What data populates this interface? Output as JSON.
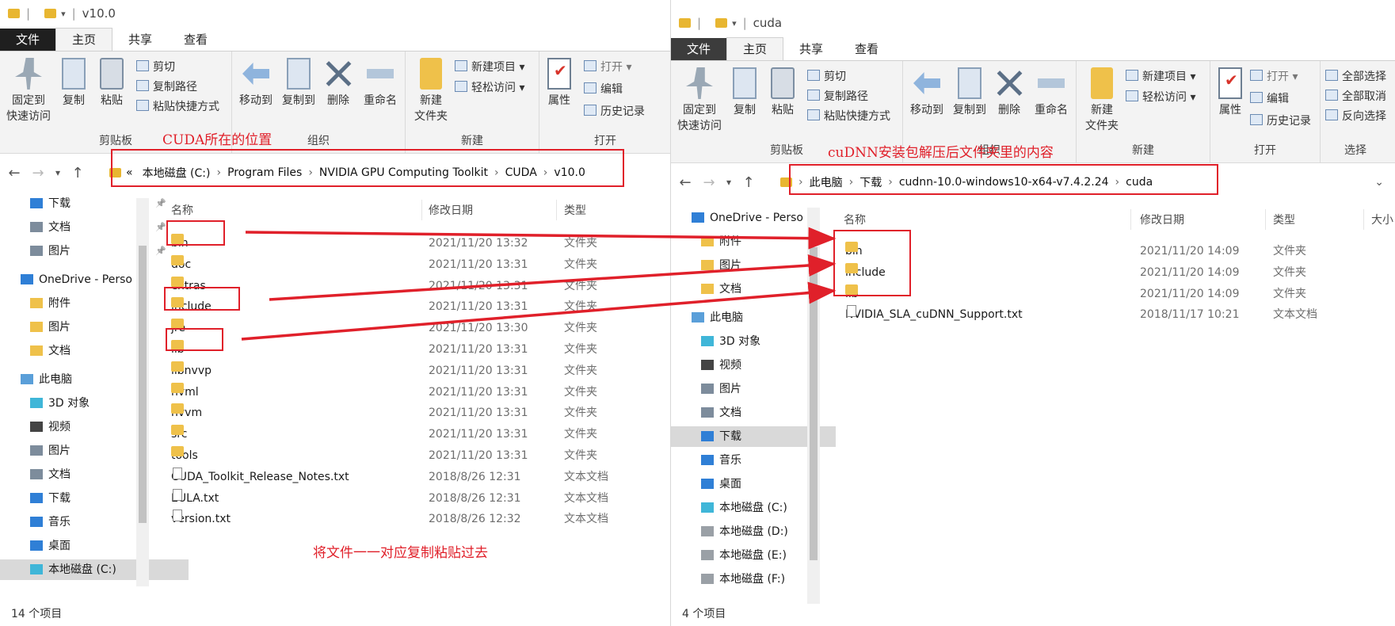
{
  "colors": {
    "annotation_red": "#e0202a",
    "folder_yellow": "#efc14a",
    "file_tab": "#1f1f1f"
  },
  "left": {
    "title": "v10.0",
    "tabs": [
      "文件",
      "主页",
      "共享",
      "查看"
    ],
    "ribbon": {
      "pin": "固定到\n快速访问",
      "copy": "复制",
      "paste": "粘贴",
      "cut": "剪切",
      "copy_path": "复制路径",
      "paste_shortcut": "粘贴快捷方式",
      "move_to": "移动到",
      "copy_to": "复制到",
      "delete": "删除",
      "rename": "重命名",
      "new_folder": "新建\n文件夹",
      "new_item": "新建项目",
      "easy_access": "轻松访问",
      "properties": "属性",
      "open": "打开",
      "edit": "编辑",
      "history": "历史记录",
      "group_clipboard": "剪贴板",
      "group_organize": "组织",
      "group_new": "新建",
      "group_open": "打开"
    },
    "breadcrumb": [
      "«",
      "本地磁盘 (C:)",
      "Program Files",
      "NVIDIA GPU Computing Toolkit",
      "CUDA",
      "v10.0"
    ],
    "tree": [
      "下载",
      "文档",
      "图片",
      "OneDrive - Perso",
      "附件",
      "图片",
      "文档",
      "此电脑",
      "3D 对象",
      "视频",
      "图片",
      "文档",
      "下载",
      "音乐",
      "桌面",
      "本地磁盘 (C:)"
    ],
    "columns": [
      "名称",
      "修改日期",
      "类型"
    ],
    "files": [
      {
        "name": "bin",
        "date": "2021/11/20 13:32",
        "type": "文件夹",
        "kind": "folder"
      },
      {
        "name": "doc",
        "date": "2021/11/20 13:31",
        "type": "文件夹",
        "kind": "folder"
      },
      {
        "name": "extras",
        "date": "2021/11/20 13:31",
        "type": "文件夹",
        "kind": "folder"
      },
      {
        "name": "include",
        "date": "2021/11/20 13:31",
        "type": "文件夹",
        "kind": "folder"
      },
      {
        "name": "jre",
        "date": "2021/11/20 13:30",
        "type": "文件夹",
        "kind": "folder"
      },
      {
        "name": "lib",
        "date": "2021/11/20 13:31",
        "type": "文件夹",
        "kind": "folder"
      },
      {
        "name": "libnvvp",
        "date": "2021/11/20 13:31",
        "type": "文件夹",
        "kind": "folder"
      },
      {
        "name": "nvml",
        "date": "2021/11/20 13:31",
        "type": "文件夹",
        "kind": "folder"
      },
      {
        "name": "nvvm",
        "date": "2021/11/20 13:31",
        "type": "文件夹",
        "kind": "folder"
      },
      {
        "name": "src",
        "date": "2021/11/20 13:31",
        "type": "文件夹",
        "kind": "folder"
      },
      {
        "name": "tools",
        "date": "2021/11/20 13:31",
        "type": "文件夹",
        "kind": "folder"
      },
      {
        "name": "CUDA_Toolkit_Release_Notes.txt",
        "date": "2018/8/26 12:31",
        "type": "文本文档",
        "kind": "txt"
      },
      {
        "name": "EULA.txt",
        "date": "2018/8/26 12:31",
        "type": "文本文档",
        "kind": "txt"
      },
      {
        "name": "version.txt",
        "date": "2018/8/26 12:32",
        "type": "文本文档",
        "kind": "txt"
      }
    ],
    "status": "14 个项目"
  },
  "right": {
    "title": "cuda",
    "tabs": [
      "文件",
      "主页",
      "共享",
      "查看"
    ],
    "ribbon": {
      "select_all": "全部选择",
      "select_none": "全部取消",
      "invert": "反向选择",
      "group_select": "选择"
    },
    "breadcrumb": [
      "此电脑",
      "下载",
      "cudnn-10.0-windows10-x64-v7.4.2.24",
      "cuda"
    ],
    "tree": [
      "OneDrive - Perso",
      "附件",
      "图片",
      "文档",
      "此电脑",
      "3D 对象",
      "视频",
      "图片",
      "文档",
      "下载",
      "音乐",
      "桌面",
      "本地磁盘 (C:)",
      "本地磁盘 (D:)",
      "本地磁盘 (E:)",
      "本地磁盘 (F:)"
    ],
    "columns": [
      "名称",
      "修改日期",
      "类型",
      "大小"
    ],
    "files": [
      {
        "name": "bin",
        "date": "2021/11/20 14:09",
        "type": "文件夹",
        "kind": "folder"
      },
      {
        "name": "include",
        "date": "2021/11/20 14:09",
        "type": "文件夹",
        "kind": "folder"
      },
      {
        "name": "lib",
        "date": "2021/11/20 14:09",
        "type": "文件夹",
        "kind": "folder"
      },
      {
        "name": "NVIDIA_SLA_cuDNN_Support.txt",
        "date": "2018/11/17 10:21",
        "type": "文本文档",
        "kind": "txt"
      }
    ],
    "status": "4 个项目"
  },
  "annotations": {
    "cuda_location": "CUDA所在的位置",
    "cudnn_content": "cuDNN安装包解压后文件夹里的内容",
    "copy_instruction": "将文件一一对应复制粘贴过去"
  }
}
